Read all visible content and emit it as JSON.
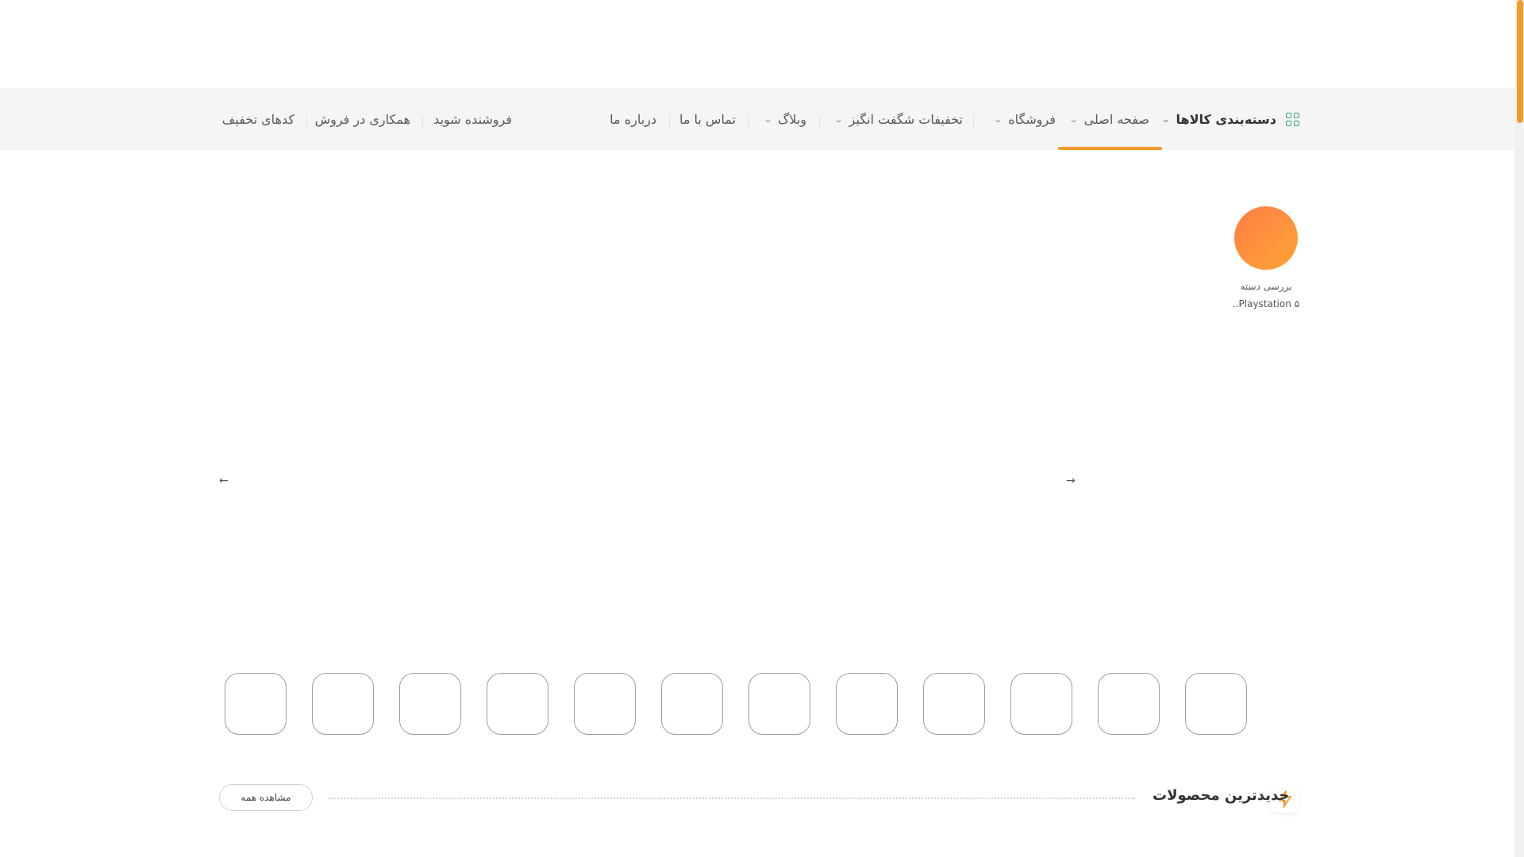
{
  "nav": {
    "categories_label": "دسته‌بندی کالاها",
    "home_label": "صفحه اصلی",
    "shop_label": "فروشگاه",
    "deals_label": "تخفیفات شگفت انگیز",
    "blog_label": "وبلاگ",
    "contact_label": "تماس با ما",
    "about_label": "درباره ما",
    "become_seller_label": "فروشنده شوید",
    "affiliate_label": "همکاری در فروش",
    "coupons_label": "کدهای تخفیف"
  },
  "story": {
    "title": "بررسی دسته",
    "subtitle": "Playstation ۵.."
  },
  "section": {
    "title": "جدیدترین محصولات",
    "view_all": "مشاهده همه"
  },
  "colors": {
    "accent": "#f39a2a",
    "story_gradient_start": "#ff7d45",
    "story_gradient_end": "#ffa536",
    "grid_icon": "#3aa07a"
  },
  "icons": {
    "grid": "grid-icon",
    "bolt": "lightning-icon",
    "chevron": "chevron-down-icon",
    "prev": "arrow-left-icon",
    "next": "arrow-right-icon"
  }
}
